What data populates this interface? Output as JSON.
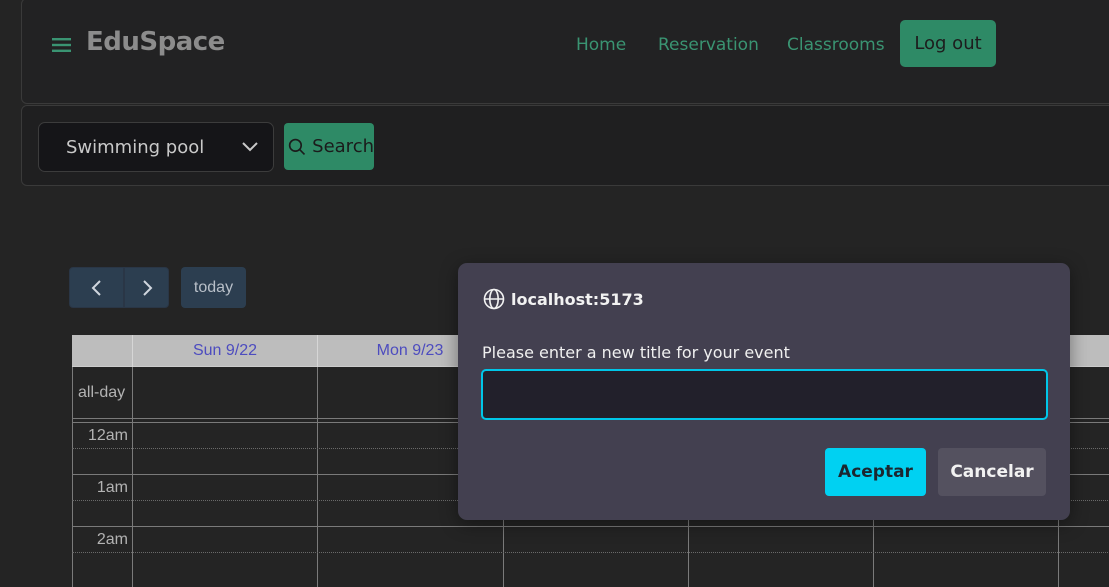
{
  "navbar": {
    "brand": "EduSpace",
    "links": [
      "Home",
      "Reservation",
      "Classrooms"
    ],
    "logout_label": "Log out",
    "accent_color": "#2e8a66"
  },
  "search": {
    "selected_room": "Swimming pool",
    "button_label": "Search"
  },
  "calendar": {
    "today_label": "today",
    "columns": [
      "Sun 9/22",
      "Mon 9/23"
    ],
    "all_day_label": "all-day",
    "time_labels": [
      "12am",
      "1am",
      "2am"
    ]
  },
  "dialog": {
    "origin": "localhost:5173",
    "message": "Please enter a new title for your event",
    "input_value": "",
    "accept_label": "Aceptar",
    "cancel_label": "Cancelar",
    "accent_color": "#00d1f2"
  }
}
